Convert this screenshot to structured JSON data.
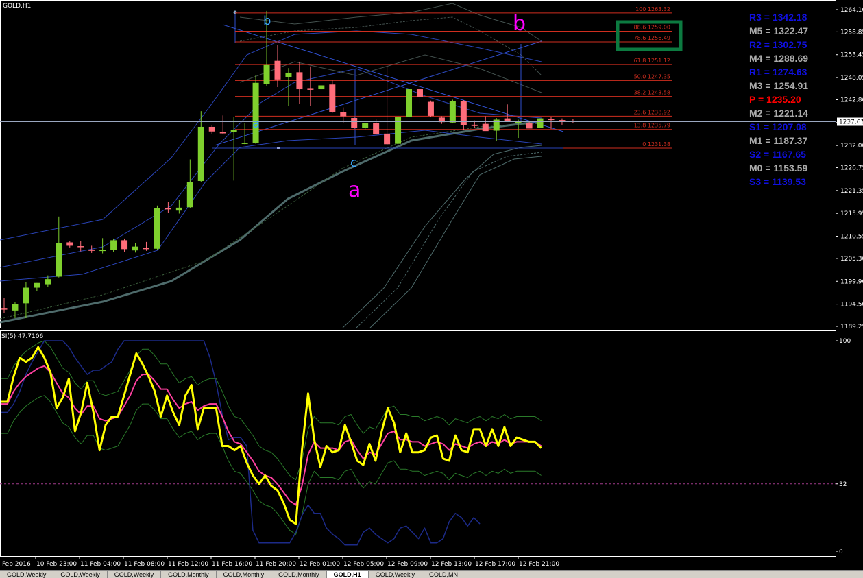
{
  "window": {
    "symbol_title": "GOLD,H1",
    "osc_title": "SI(5) 47.7106"
  },
  "colors": {
    "bull": "#7fd02d",
    "bear": "#ff6d7a",
    "fib": "#d02e1f",
    "pivot_blue": "#1010e0",
    "pivot_grey": "#aaaaaa",
    "pivot_red": "#ff0000",
    "stoch_yellow": "#ffff00",
    "stoch_magenta": "#ff40a0",
    "highlight_box": "#0c7a40"
  },
  "chart_data": {
    "type": "candlestick",
    "price_axis": {
      "ticks": [
        "1264.10",
        "1258.85",
        "1253.45",
        "1248.05",
        "1242.80",
        "1237.40",
        "1232.00",
        "1226.75",
        "1221.35",
        "1215.95",
        "1210.55",
        "1205.30",
        "1199.90",
        "1194.50",
        "1189.25"
      ],
      "current_price": "1237.61"
    },
    "time_axis": [
      "Feb 2016",
      "10 Feb 23:00",
      "11 Feb 04:00",
      "11 Feb 08:00",
      "11 Feb 12:00",
      "11 Feb 16:00",
      "11 Feb 20:00",
      "12 Feb 01:00",
      "12 Feb 05:00",
      "12 Feb 09:00",
      "12 Feb 13:00",
      "12 Feb 17:00",
      "12 Feb 21:00"
    ],
    "candles": [
      {
        "o": 1193.6,
        "h": 1195.9,
        "l": 1192.4,
        "c": 1193.2
      },
      {
        "o": 1193.0,
        "h": 1195.0,
        "l": 1191.2,
        "c": 1194.5
      },
      {
        "o": 1194.7,
        "h": 1199.7,
        "l": 1191.2,
        "c": 1198.4
      },
      {
        "o": 1198.4,
        "h": 1199.5,
        "l": 1197.6,
        "c": 1199.5
      },
      {
        "o": 1199.2,
        "h": 1201.3,
        "l": 1198.5,
        "c": 1200.4
      },
      {
        "o": 1201.0,
        "h": 1215.2,
        "l": 1200.8,
        "c": 1209.0
      },
      {
        "o": 1209.1,
        "h": 1209.5,
        "l": 1207.9,
        "c": 1208.3
      },
      {
        "o": 1208.2,
        "h": 1209.5,
        "l": 1207.0,
        "c": 1208.0
      },
      {
        "o": 1207.4,
        "h": 1208.3,
        "l": 1206.6,
        "c": 1207.1
      },
      {
        "o": 1207.1,
        "h": 1210.1,
        "l": 1206.5,
        "c": 1207.3
      },
      {
        "o": 1207.3,
        "h": 1210.0,
        "l": 1206.8,
        "c": 1209.6
      },
      {
        "o": 1209.6,
        "h": 1210.0,
        "l": 1206.9,
        "c": 1207.5
      },
      {
        "o": 1207.2,
        "h": 1208.9,
        "l": 1206.7,
        "c": 1208.1
      },
      {
        "o": 1207.8,
        "h": 1209.2,
        "l": 1207.1,
        "c": 1207.5
      },
      {
        "o": 1207.6,
        "h": 1217.8,
        "l": 1207.4,
        "c": 1217.2
      },
      {
        "o": 1217.2,
        "h": 1218.6,
        "l": 1216.0,
        "c": 1216.9
      },
      {
        "o": 1216.6,
        "h": 1219.2,
        "l": 1215.9,
        "c": 1217.3
      },
      {
        "o": 1217.4,
        "h": 1228.7,
        "l": 1217.2,
        "c": 1223.4
      },
      {
        "o": 1223.6,
        "h": 1240.1,
        "l": 1223.3,
        "c": 1236.4
      },
      {
        "o": 1236.4,
        "h": 1236.8,
        "l": 1234.7,
        "c": 1235.3
      },
      {
        "o": 1235.1,
        "h": 1239.1,
        "l": 1234.7,
        "c": 1234.9
      },
      {
        "o": 1235.2,
        "h": 1238.7,
        "l": 1223.7,
        "c": 1235.6
      },
      {
        "o": 1232.5,
        "h": 1237.2,
        "l": 1232.3,
        "c": 1232.6
      },
      {
        "o": 1232.6,
        "h": 1248.7,
        "l": 1232.4,
        "c": 1246.8
      },
      {
        "o": 1246.5,
        "h": 1263.8,
        "l": 1246.0,
        "c": 1251.0
      },
      {
        "o": 1252.0,
        "h": 1255.8,
        "l": 1245.8,
        "c": 1247.6
      },
      {
        "o": 1248.2,
        "h": 1250.3,
        "l": 1241.3,
        "c": 1249.2
      },
      {
        "o": 1249.3,
        "h": 1251.8,
        "l": 1241.9,
        "c": 1245.3
      },
      {
        "o": 1245.4,
        "h": 1250.7,
        "l": 1241.3,
        "c": 1245.3
      },
      {
        "o": 1245.3,
        "h": 1246.2,
        "l": 1245.3,
        "c": 1246.2
      },
      {
        "o": 1246.4,
        "h": 1247.5,
        "l": 1239.7,
        "c": 1239.9
      },
      {
        "o": 1239.9,
        "h": 1241.0,
        "l": 1237.4,
        "c": 1238.9
      },
      {
        "o": 1238.5,
        "h": 1238.9,
        "l": 1235.9,
        "c": 1236.1
      },
      {
        "o": 1236.1,
        "h": 1237.3,
        "l": 1235.8,
        "c": 1237.3
      },
      {
        "o": 1237.3,
        "h": 1238.2,
        "l": 1234.6,
        "c": 1234.6
      },
      {
        "o": 1234.8,
        "h": 1250.7,
        "l": 1232.1,
        "c": 1232.3
      },
      {
        "o": 1232.4,
        "h": 1239.0,
        "l": 1232.0,
        "c": 1238.7
      },
      {
        "o": 1238.8,
        "h": 1245.7,
        "l": 1238.4,
        "c": 1245.3
      },
      {
        "o": 1245.3,
        "h": 1245.8,
        "l": 1242.0,
        "c": 1243.4
      },
      {
        "o": 1242.3,
        "h": 1242.6,
        "l": 1238.7,
        "c": 1239.0
      },
      {
        "o": 1238.6,
        "h": 1238.9,
        "l": 1237.1,
        "c": 1237.5
      },
      {
        "o": 1237.4,
        "h": 1242.8,
        "l": 1237.2,
        "c": 1242.4
      },
      {
        "o": 1242.4,
        "h": 1242.7,
        "l": 1235.6,
        "c": 1236.8
      },
      {
        "o": 1236.9,
        "h": 1237.9,
        "l": 1236.1,
        "c": 1236.6
      },
      {
        "o": 1237.1,
        "h": 1238.9,
        "l": 1235.6,
        "c": 1235.4
      },
      {
        "o": 1235.5,
        "h": 1238.5,
        "l": 1233.0,
        "c": 1238.1
      },
      {
        "o": 1238.4,
        "h": 1241.7,
        "l": 1237.8,
        "c": 1237.6
      },
      {
        "o": 1237.5,
        "h": 1238.1,
        "l": 1233.8,
        "c": 1237.6
      },
      {
        "o": 1237.2,
        "h": 1237.7,
        "l": 1236.0,
        "c": 1236.0
      },
      {
        "o": 1236.2,
        "h": 1238.4,
        "l": 1236.1,
        "c": 1238.4
      },
      {
        "o": 1238.3,
        "h": 1238.7,
        "l": 1235.9,
        "c": 1238.0
      },
      {
        "o": 1238.0,
        "h": 1238.4,
        "l": 1236.9,
        "c": 1237.7
      },
      {
        "o": 1237.8,
        "h": 1238.2,
        "l": 1237.3,
        "c": 1237.6
      }
    ],
    "fib_levels": [
      {
        "label": "100 1263.32",
        "price": 1263.32
      },
      {
        "label": "88.6 1259.00",
        "price": 1259.0
      },
      {
        "label": "78.6 1256.49",
        "price": 1256.49
      },
      {
        "label": "61.8 1251.12",
        "price": 1251.12
      },
      {
        "label": "50.0 1247.35",
        "price": 1247.35
      },
      {
        "label": "38.2 1243.58",
        "price": 1243.58
      },
      {
        "label": "23.6 1238.92",
        "price": 1238.92
      },
      {
        "label": "13.8 1235.79",
        "price": 1235.79
      },
      {
        "label": "0 1231.38",
        "price": 1231.38
      }
    ],
    "wave_labels": [
      {
        "text": "b",
        "color": "#3aa8ff",
        "size": "small"
      },
      {
        "text": "a",
        "color": "#3aa8ff",
        "size": "small"
      },
      {
        "text": "c",
        "color": "#3aa8ff",
        "size": "small"
      },
      {
        "text": "b",
        "color": "#ff00ff",
        "size": "large"
      },
      {
        "text": "a",
        "color": "#ff00ff",
        "size": "large"
      }
    ],
    "pivots": [
      {
        "label": "R3 = 1342.18",
        "color": "#1010e0"
      },
      {
        "label": "M5 = 1322.47",
        "color": "#aaaaaa"
      },
      {
        "label": "R2 = 1302.75",
        "color": "#1010e0"
      },
      {
        "label": "M4 = 1288.69",
        "color": "#aaaaaa"
      },
      {
        "label": "R1 = 1274.63",
        "color": "#1010e0"
      },
      {
        "label": "M3 = 1254.91",
        "color": "#aaaaaa"
      },
      {
        "label": "P   = 1235.20",
        "color": "#ff0000"
      },
      {
        "label": "M2 = 1221.14",
        "color": "#aaaaaa"
      },
      {
        "label": "S1 = 1207.08",
        "color": "#1010e0"
      },
      {
        "label": "M1 = 1187.37",
        "color": "#aaaaaa"
      },
      {
        "label": "S2 = 1167.65",
        "color": "#1010e0"
      },
      {
        "label": "M0 = 1153.59",
        "color": "#aaaaaa"
      },
      {
        "label": "S3 = 1139.53",
        "color": "#1010e0"
      }
    ],
    "oscillator": {
      "ticks": [
        "100",
        "32",
        "0"
      ],
      "level": 32,
      "yellow": [
        71,
        71,
        83,
        92,
        90,
        92,
        97,
        92,
        85,
        68,
        73,
        82,
        57,
        66,
        80,
        66,
        48,
        60,
        64,
        64,
        74,
        84,
        94,
        89,
        83,
        76,
        64,
        74,
        66,
        60,
        74,
        79,
        58,
        68,
        68,
        68,
        50,
        50,
        48,
        50,
        42,
        36,
        32,
        36,
        31,
        29,
        23,
        15,
        13,
        48,
        75,
        53,
        40,
        50,
        47,
        48,
        60,
        52,
        43,
        41,
        51,
        43,
        57,
        68,
        61,
        47,
        56,
        47,
        47,
        48,
        54,
        55,
        44,
        43,
        55,
        48,
        47,
        58,
        58,
        50,
        58,
        50,
        59,
        50,
        54,
        53,
        52,
        52,
        49
      ],
      "magenta": [
        70,
        70,
        76,
        80,
        83,
        85,
        87,
        88,
        85,
        80,
        75,
        73,
        68,
        65,
        69,
        69,
        63,
        62,
        63,
        64,
        69,
        74,
        81,
        84,
        84,
        81,
        77,
        77,
        72,
        68,
        70,
        71,
        67,
        69,
        70,
        70,
        64,
        57,
        52,
        51,
        47,
        43,
        38,
        36,
        35,
        32,
        28,
        24,
        22,
        31,
        46,
        52,
        49,
        49,
        49,
        48,
        52,
        53,
        48,
        44,
        47,
        46,
        51,
        56,
        57,
        53,
        53,
        52,
        52,
        50,
        51,
        52,
        51,
        48,
        51,
        50,
        49,
        51,
        52,
        50,
        52,
        51,
        53,
        51,
        52,
        52,
        52,
        52,
        50
      ],
      "navy": [
        66,
        66,
        70,
        76,
        84,
        90,
        95,
        100,
        100,
        100,
        100,
        97,
        92,
        88,
        84,
        86,
        86,
        88,
        90,
        96,
        100,
        100,
        100,
        100,
        100,
        100,
        100,
        100,
        100,
        100,
        100,
        100,
        100,
        100,
        92,
        80,
        65,
        53,
        54,
        54,
        50,
        10,
        4,
        4,
        4,
        4,
        4,
        4,
        9,
        17,
        22,
        18,
        18,
        11,
        8,
        6,
        3,
        3,
        3,
        9,
        11,
        8,
        6,
        4,
        6,
        11,
        12,
        9,
        6,
        11,
        4,
        4,
        6,
        14,
        18,
        16,
        12,
        16,
        13
      ]
    }
  },
  "tabs": [
    "GOLD,Weekly",
    "GOLD,Weekly",
    "GOLD,Weekly",
    "GOLD,Monthly",
    "GOLD,Monthly",
    "GOLD,Monthly",
    "GOLD,H1",
    "GOLD,Weekly",
    "GOLD,MN"
  ]
}
